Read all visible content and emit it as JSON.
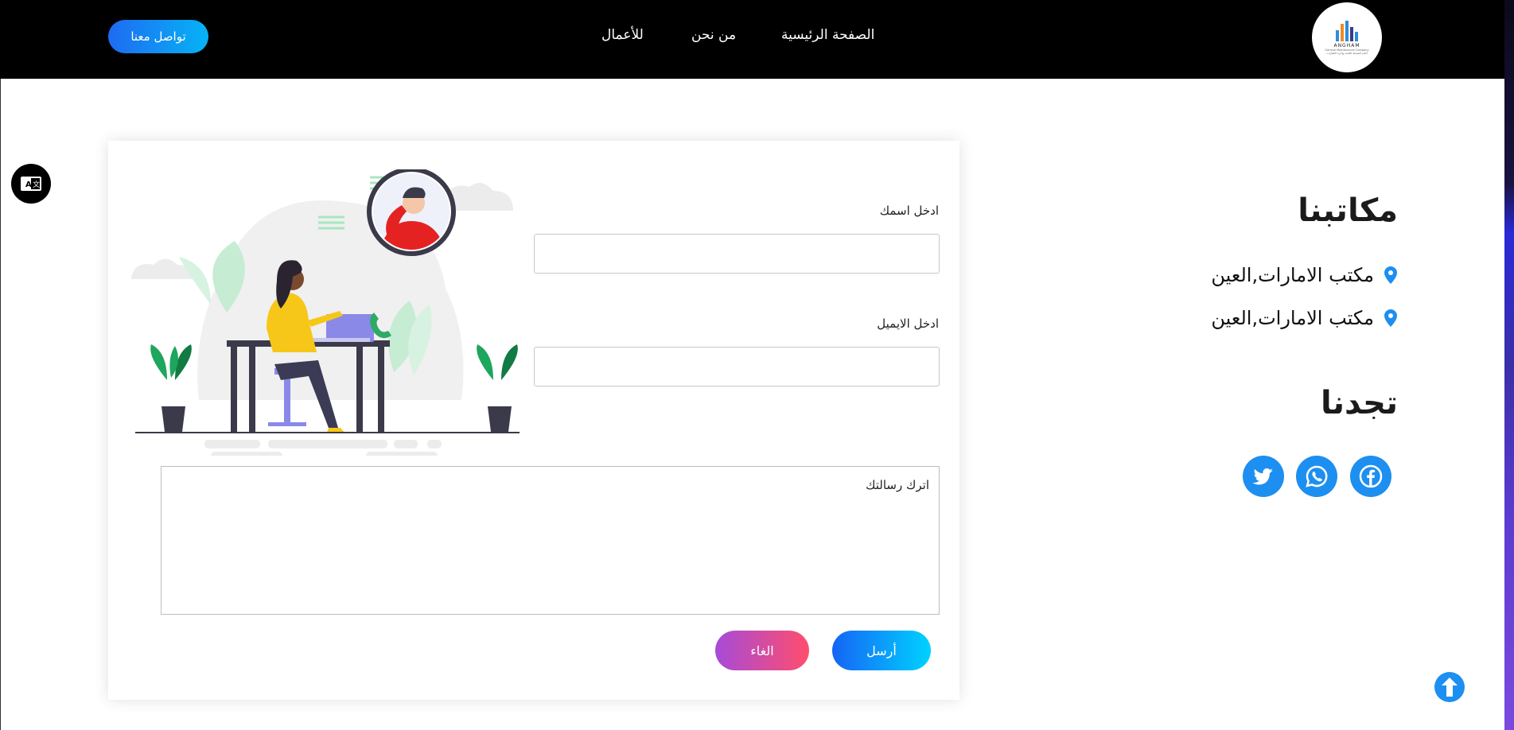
{
  "nav": {
    "logo": {
      "name": "ANGHAM",
      "tagline": "General Maintenance Company",
      "arabic_tagline": "أنغام للصيانة العامة وإدارة العقارات"
    },
    "links": [
      "الصفحة الرئيسية",
      "من نحن",
      "للأعمال"
    ],
    "contact_button": "تواصل معنا"
  },
  "form": {
    "name_label": "ادخل اسمك",
    "name_value": "",
    "email_label": "ادخل الايميل",
    "email_value": "",
    "message_placeholder": "اترك رسالتك",
    "send_button": "أرسل",
    "cancel_button": "الغاء"
  },
  "offices": {
    "heading": "مكاتبنا",
    "items": [
      "مكتب الامارات,العين",
      "مكتب الامارات,العين"
    ]
  },
  "find_us": {
    "heading": "تجدنا",
    "socials": [
      "facebook-icon",
      "whatsapp-icon",
      "twitter-icon"
    ]
  },
  "colors": {
    "accent": "#1d8ff0",
    "send_gradient": [
      "#1565f5",
      "#00d2ff"
    ],
    "cancel_gradient": [
      "#a74bd8",
      "#ff4d6d"
    ]
  }
}
